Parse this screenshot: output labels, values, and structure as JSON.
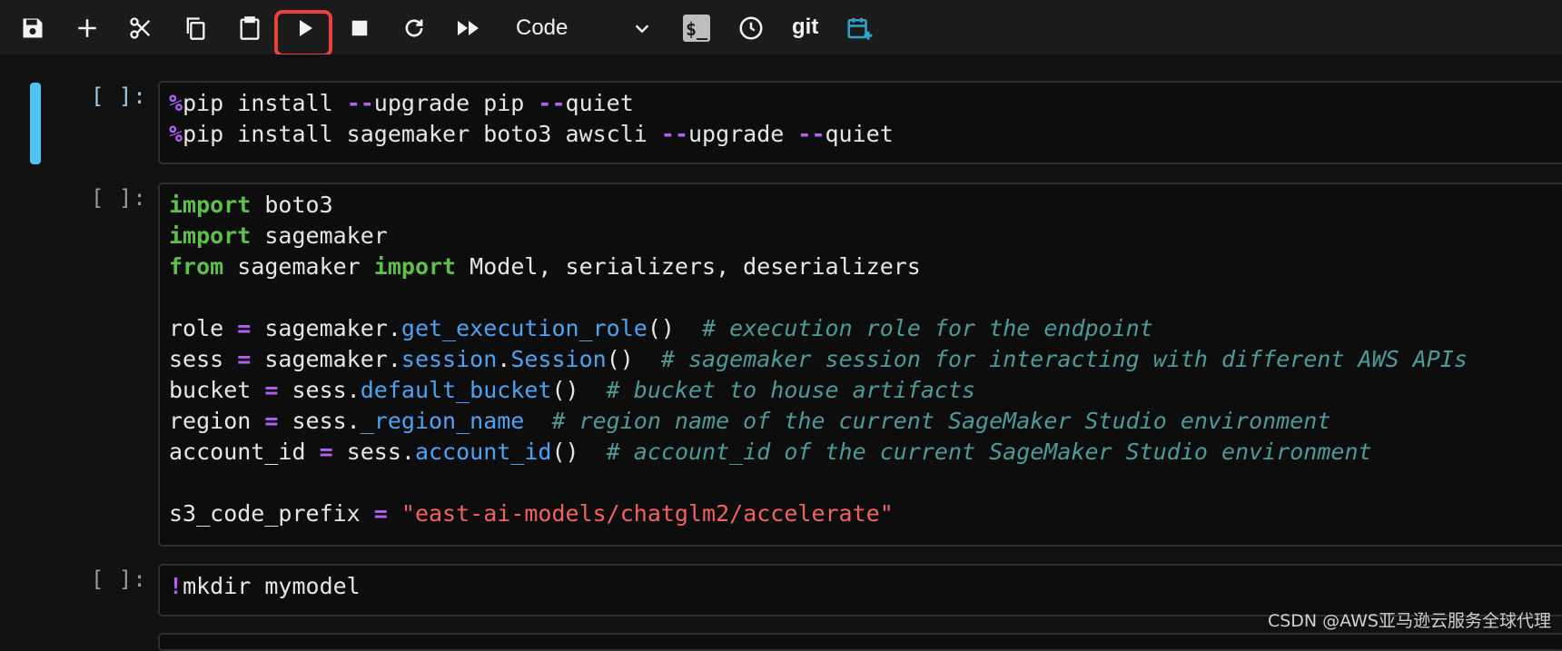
{
  "toolbar": {
    "cell_type": "Code",
    "git_label": "git",
    "icons": [
      "save-icon",
      "add-icon",
      "cut-icon",
      "copy-icon",
      "paste-icon",
      "run-icon",
      "stop-icon",
      "restart-icon",
      "fast-forward-icon",
      "terminal-icon",
      "clock-icon",
      "git-icon",
      "calendar-add-icon"
    ]
  },
  "cells": [
    {
      "prompt": "[ ]:",
      "lines": [
        [
          [
            "op",
            "%"
          ],
          [
            "t",
            "pip install "
          ],
          [
            "op",
            "--"
          ],
          [
            "t",
            "upgrade pip "
          ],
          [
            "op",
            "--"
          ],
          [
            "t",
            "quiet"
          ]
        ],
        [
          [
            "op",
            "%"
          ],
          [
            "t",
            "pip install sagemaker boto3 awscli "
          ],
          [
            "op",
            "--"
          ],
          [
            "t",
            "upgrade "
          ],
          [
            "op",
            "--"
          ],
          [
            "t",
            "quiet"
          ]
        ]
      ]
    },
    {
      "prompt": "[ ]:",
      "lines": [
        [
          [
            "kw",
            "import"
          ],
          [
            "t",
            " boto3"
          ]
        ],
        [
          [
            "kw",
            "import"
          ],
          [
            "t",
            " sagemaker"
          ]
        ],
        [
          [
            "kw",
            "from"
          ],
          [
            "t",
            " sagemaker "
          ],
          [
            "kw",
            "import"
          ],
          [
            "t",
            " Model, serializers, deserializers"
          ]
        ],
        [
          [
            "t",
            ""
          ]
        ],
        [
          [
            "t",
            "role "
          ],
          [
            "op",
            "="
          ],
          [
            "t",
            " sagemaker."
          ],
          [
            "fn",
            "get_execution_role"
          ],
          [
            "t",
            "()  "
          ],
          [
            "cm",
            "# execution role for the endpoint"
          ]
        ],
        [
          [
            "t",
            "sess "
          ],
          [
            "op",
            "="
          ],
          [
            "t",
            " sagemaker."
          ],
          [
            "fn",
            "session"
          ],
          [
            "t",
            "."
          ],
          [
            "fn",
            "Session"
          ],
          [
            "t",
            "()  "
          ],
          [
            "cm",
            "# sagemaker session for interacting with different AWS APIs"
          ]
        ],
        [
          [
            "t",
            "bucket "
          ],
          [
            "op",
            "="
          ],
          [
            "t",
            " sess."
          ],
          [
            "fn",
            "default_bucket"
          ],
          [
            "t",
            "()  "
          ],
          [
            "cm",
            "# bucket to house artifacts"
          ]
        ],
        [
          [
            "t",
            "region "
          ],
          [
            "op",
            "="
          ],
          [
            "t",
            " sess."
          ],
          [
            "fn",
            "_region_name"
          ],
          [
            "t",
            "  "
          ],
          [
            "cm",
            "# region name of the current SageMaker Studio environment"
          ]
        ],
        [
          [
            "t",
            "account_id "
          ],
          [
            "op",
            "="
          ],
          [
            "t",
            " sess."
          ],
          [
            "fn",
            "account_id"
          ],
          [
            "t",
            "()  "
          ],
          [
            "cm",
            "# account_id of the current SageMaker Studio environment"
          ]
        ],
        [
          [
            "t",
            ""
          ]
        ],
        [
          [
            "t",
            "s3_code_prefix "
          ],
          [
            "op",
            "="
          ],
          [
            "t",
            " "
          ],
          [
            "st",
            "\"east-ai-models/chatglm2/accelerate\""
          ]
        ]
      ]
    },
    {
      "prompt": "[ ]:",
      "lines": [
        [
          [
            "op",
            "!"
          ],
          [
            "t",
            "mkdir mymodel"
          ]
        ]
      ]
    }
  ],
  "watermark": "CSDN @AWS亚马逊云服务全球代理"
}
